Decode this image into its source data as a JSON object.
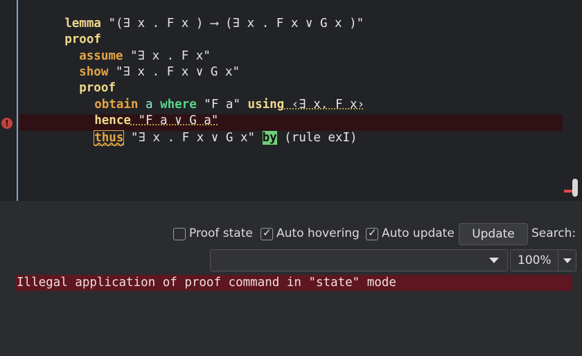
{
  "editor": {
    "lines": [
      {
        "kw": "lemma",
        "text": " \"(∃ x . F x ) ⟶ (∃ x . F x ∨ G x )\""
      },
      {
        "kw": "proof"
      },
      {
        "kw2": "assume",
        "text": " \"∃ x . F x\""
      },
      {
        "kw2": "show",
        "text": " \"∃ x . F x ∨ G x\""
      },
      {
        "kw": "proof"
      },
      {
        "kw2": "obtain",
        "var": "a",
        "where": "where",
        "text1": " \"F a\" ",
        "using": "using",
        "text2": " ‹∃ x. F x›"
      },
      {
        "kw": "hence",
        "text": " \"F a ∨ G a\""
      },
      {
        "kw2": "thus",
        "text": " \"∃ x . F x ∨ G x\" ",
        "by": "by",
        "rest": " (rule exI)"
      }
    ],
    "error_icon": "!"
  },
  "toolbar": {
    "proof_state": {
      "label": "Proof state",
      "checked": false
    },
    "auto_hovering": {
      "label": "Auto hovering",
      "checked": true
    },
    "auto_update": {
      "label": "Auto update",
      "checked": true
    },
    "update_label": "Update",
    "search_label": "Search:",
    "search_value": "",
    "zoom_value": "100%"
  },
  "output": {
    "message": "Illegal application of proof command in \"state\" mode",
    "message_bg": "#5e1620"
  },
  "colors": {
    "editor_bg": "#222326",
    "error_row": "#2f1115",
    "keyword_yellow": "#f0d98c",
    "keyword_orange": "#e5a545",
    "keyword_green": "#56d68a"
  }
}
